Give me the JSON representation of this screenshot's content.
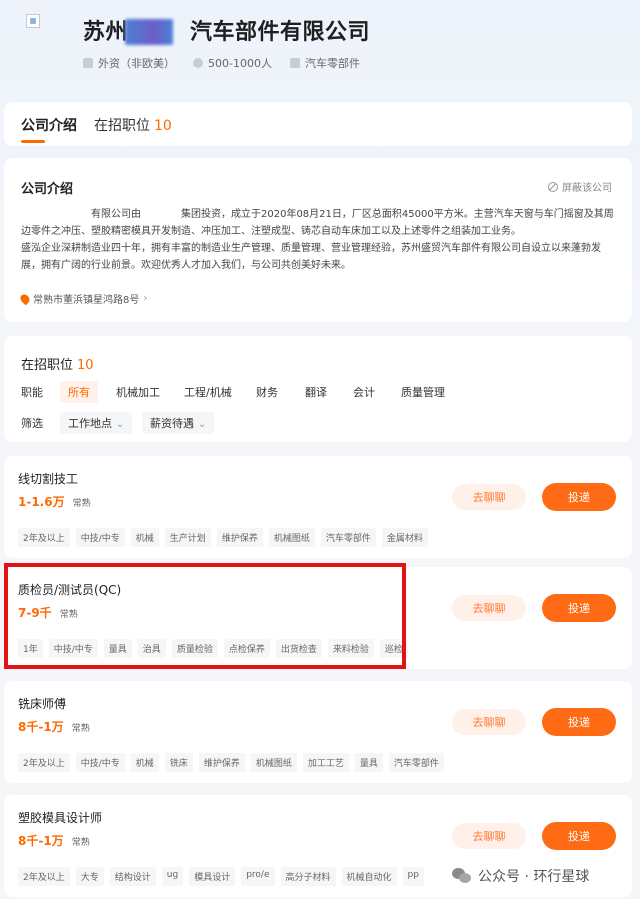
{
  "company": {
    "name_prefix": "苏州",
    "name_suffix": "汽车部件有限公司",
    "meta": {
      "ownership": "外资（非欧美）",
      "size": "500-1000人",
      "industry": "汽车零部件"
    }
  },
  "tabs": [
    {
      "label": "公司介绍",
      "count": ""
    },
    {
      "label": "在招职位",
      "count": "10"
    }
  ],
  "intro": {
    "title": "公司介绍",
    "block_label": "屏蔽该公司",
    "line1a": "有限公司由",
    "line1b": "集团投资，成立于2020年08月21日，厂区总面积45000平方米。主营汽车天窗与车门摇窗及其周",
    "line2": "边零件之冲压、塑胶精密模具开发制造、冲压加工、注塑成型、铸芯自动车床加工以及上述零件之组装加工业务。",
    "line3": "盛泓企业深耕制造业四十年，拥有丰富的制造业生产管理、质量管理、营业管理经验，苏州盛贸汽车部件有限公司自设立以来蓬勃发",
    "line4": "展，拥有广阔的行业前景。欢迎优秀人才加入我们，与公司共创美好未来。",
    "address": "常熟市董浜镇星鸿路8号"
  },
  "filters": {
    "title": "在招职位",
    "count": "10",
    "function_label": "职能",
    "function_options": [
      "所有",
      "机械加工",
      "工程/机械",
      "财务",
      "翻译",
      "会计",
      "质量管理"
    ],
    "filter_label": "筛选",
    "dropdowns": [
      "工作地点",
      "薪资待遇"
    ]
  },
  "jobs": [
    {
      "title": "线切割技工",
      "salary": "1-1.6万",
      "pay_tag": "常熟",
      "tags": [
        "2年及以上",
        "中技/中专",
        "机械",
        "生产计划",
        "维护保养",
        "机械图纸",
        "汽车零部件",
        "金属材料"
      ],
      "chat_label": "去聊聊",
      "apply_label": "投递"
    },
    {
      "title": "质检员/测试员(QC)",
      "salary": "7-9千",
      "pay_tag": "常熟",
      "tags": [
        "1年",
        "中技/中专",
        "量具",
        "治具",
        "质量检验",
        "点检保养",
        "出货检查",
        "来料检验",
        "巡检"
      ],
      "chat_label": "去聊聊",
      "apply_label": "投递"
    },
    {
      "title": "铣床师傅",
      "salary": "8千-1万",
      "pay_tag": "常熟",
      "tags": [
        "2年及以上",
        "中技/中专",
        "机械",
        "铣床",
        "维护保养",
        "机械图纸",
        "加工工艺",
        "量具",
        "汽车零部件"
      ],
      "chat_label": "去聊聊",
      "apply_label": "投递"
    },
    {
      "title": "塑胶模具设计师",
      "salary": "8千-1万",
      "pay_tag": "常熟",
      "tags": [
        "2年及以上",
        "大专",
        "结构设计",
        "ug",
        "模具设计",
        "pro/e",
        "高分子材料",
        "机械自动化",
        "pp"
      ],
      "chat_label": "去聊聊",
      "apply_label": "投递"
    }
  ],
  "watermark": "公众号 · 环行星球",
  "colors": {
    "accent": "#ff6a00",
    "highlight": "#e21313"
  }
}
